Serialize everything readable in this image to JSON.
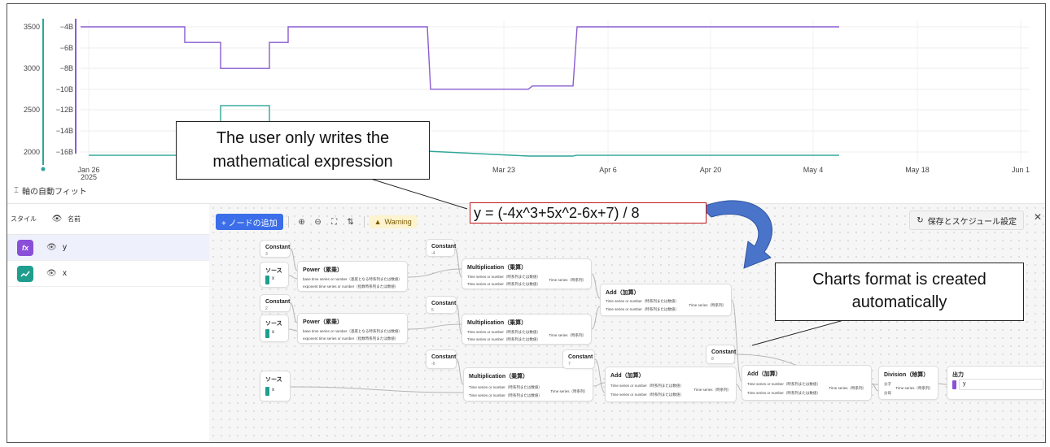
{
  "chart": {
    "left_axis_ticks": [
      "3500",
      "3000",
      "2500",
      "2000"
    ],
    "right_axis_ticks": [
      "−4B",
      "−6B",
      "−8B",
      "−10B",
      "−12B",
      "−14B",
      "−16B"
    ],
    "x_ticks": [
      {
        "line1": "Jan 26",
        "line2": "2025"
      },
      {
        "line1": "Mar 23",
        "line2": ""
      },
      {
        "line1": "Apr 6",
        "line2": ""
      },
      {
        "line1": "Apr 20",
        "line2": ""
      },
      {
        "line1": "May 4",
        "line2": ""
      },
      {
        "line1": "May 18",
        "line2": ""
      },
      {
        "line1": "Jun 1",
        "line2": ""
      }
    ],
    "autofit_label": "軸の自動フィット"
  },
  "chart_data": {
    "type": "line",
    "series": [
      {
        "color": "#8a5cd1",
        "axis": "right",
        "values": [
          -4,
          -5.5,
          -8,
          -5.5,
          -4,
          -10,
          -4
        ]
      },
      {
        "color": "#2ea59a",
        "axis": "left",
        "values": [
          1950,
          2550,
          1950,
          2000,
          1950
        ]
      }
    ],
    "right_ylim": [
      "-17B",
      "-3B"
    ],
    "left_ylim": [
      1900,
      3600
    ],
    "grid": true
  },
  "colors": {
    "series_x": "#2ea59a",
    "series_y": "#8a5cd1",
    "accent": "#3b6ee8",
    "warning_bg": "#fdf3cf",
    "annotation_border": "#c01818",
    "arrow": "#4a74c9"
  },
  "left_panel": {
    "header": {
      "style": "スタイル",
      "eye": "👁",
      "name": "名前"
    },
    "rows": [
      {
        "icon": "fx",
        "label": "y",
        "color": "#8a4fd8",
        "selected": true
      },
      {
        "icon": "~",
        "label": "x",
        "color": "#1f9e8e",
        "selected": false
      }
    ]
  },
  "toolbar": {
    "add_node": "+ ノードの追加",
    "warning": "Warning",
    "save": "保存とスケジュール設定"
  },
  "nodes": {
    "const1": {
      "title": "Constant",
      "sub": "3"
    },
    "src1": {
      "title": "ソース",
      "chip": "x"
    },
    "pow1": {
      "title": "Power（累乗）",
      "in1": "base time series or number（基底となる時系列または数値）",
      "in2": "exponent time series or number（指数時系列または数値）",
      "out": "Time series（時系列）"
    },
    "const2": {
      "title": "Constant",
      "sub": "-4"
    },
    "mul1": {
      "title": "Multiplication（乗算）",
      "in1": "Time series or number（時系列または数値）",
      "in2": "Time series or number（時系列または数値）",
      "out": "Time series（時系列）"
    },
    "const3": {
      "title": "Constant",
      "sub": "2"
    },
    "src2": {
      "title": "ソース",
      "chip": "x"
    },
    "pow2": {
      "title": "Power（累乗）",
      "in1": "base time series or number（基底となる時系列または数値）",
      "in2": "exponent time series or number（指数時系列または数値）",
      "out": "Time series（時系列）"
    },
    "const4": {
      "title": "Constant",
      "sub": "5"
    },
    "mul2": {
      "title": "Multiplication（乗算）",
      "in1": "Time series or number（時系列または数値）",
      "in2": "Time series or number（時系列または数値）",
      "out": "Time series（時系列）"
    },
    "add1": {
      "title": "Add（加算）",
      "in1": "Time series or number（時系列または数値）",
      "in2": "Time series or number（時系列または数値）",
      "out": "Time series（時系列）"
    },
    "const5": {
      "title": "Constant",
      "sub": "-6"
    },
    "src3": {
      "title": "ソース",
      "chip": "x"
    },
    "mul3": {
      "title": "Multiplication（乗算）",
      "in1": "Time series or number（時系列または数値）",
      "in2": "Time series or number（時系列または数値）",
      "out": "Time series（時系列）"
    },
    "const6": {
      "title": "Constant",
      "sub": "7"
    },
    "add2": {
      "title": "Add（加算）",
      "in1": "Time series or number（時系列または数値）",
      "in2": "Time series or number（時系列または数値）",
      "out": "Time series（時系列）"
    },
    "const7": {
      "title": "Constant",
      "sub": "8"
    },
    "add3": {
      "title": "Add（加算）",
      "in1": "Time series or number（時系列または数値）",
      "in2": "Time series or number（時系列または数値）",
      "out": "Time series（時系列）"
    },
    "div1": {
      "title": "Division（除算）",
      "in1": "分子",
      "in2": "分母",
      "out": "Time series（時系列）"
    },
    "output": {
      "title": "出力",
      "value": "y"
    }
  },
  "annotations": {
    "user_writes": [
      "The user only writes the",
      "mathematical expression"
    ],
    "expression": "y = (-4x^3+5x^2-6x+7) / 8",
    "charts_format": [
      "Charts format is created",
      "automatically"
    ]
  }
}
